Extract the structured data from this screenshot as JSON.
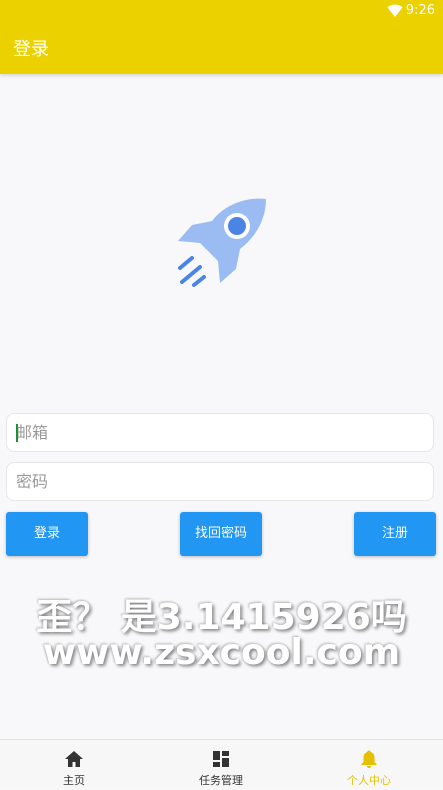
{
  "status_bar": {
    "time": "9:26",
    "wifi_icon": "wifi-icon"
  },
  "app_bar": {
    "title": "登录"
  },
  "logo": {
    "icon": "rocket-icon",
    "color": "#9bbcf2"
  },
  "form": {
    "email": {
      "placeholder": "邮箱",
      "value": ""
    },
    "password": {
      "placeholder": "密码",
      "value": ""
    }
  },
  "buttons": {
    "login": "登录",
    "recover": "找回密码",
    "register": "注册"
  },
  "watermark": {
    "line1": "歪？ 是3.1415926吗",
    "line2": "www.zsxcool.com"
  },
  "tabbar": {
    "items": [
      {
        "label": "主页",
        "icon": "home-icon",
        "active": false
      },
      {
        "label": "任务管理",
        "icon": "dashboard-icon",
        "active": false
      },
      {
        "label": "个人中心",
        "icon": "bell-icon",
        "active": true
      }
    ]
  },
  "colors": {
    "primary_yellow": "#ecd100",
    "button_blue": "#2196f3",
    "active_tab": "#e6c000"
  }
}
